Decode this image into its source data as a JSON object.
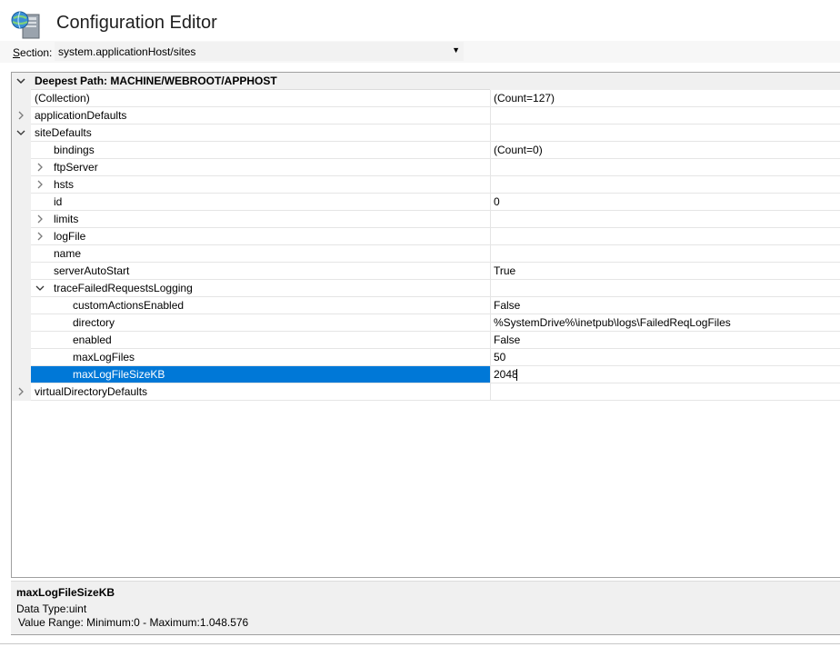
{
  "header": {
    "title": "Configuration Editor",
    "icon": "config-editor-icon"
  },
  "section": {
    "label_prefix": "S",
    "label_rest": "ection:",
    "value": "system.applicationHost/sites"
  },
  "grid": {
    "header_label": "Deepest Path: MACHINE/WEBROOT/APPHOST",
    "rows": [
      {
        "name": "(Collection)",
        "value": "(Count=127)"
      },
      {
        "name": "applicationDefaults",
        "value": ""
      },
      {
        "name": "siteDefaults",
        "value": ""
      },
      {
        "name": "bindings",
        "value": "(Count=0)"
      },
      {
        "name": "ftpServer",
        "value": ""
      },
      {
        "name": "hsts",
        "value": ""
      },
      {
        "name": "id",
        "value": "0"
      },
      {
        "name": "limits",
        "value": ""
      },
      {
        "name": "logFile",
        "value": ""
      },
      {
        "name": "name",
        "value": ""
      },
      {
        "name": "serverAutoStart",
        "value": "True"
      },
      {
        "name": "traceFailedRequestsLogging",
        "value": ""
      },
      {
        "name": "customActionsEnabled",
        "value": "False"
      },
      {
        "name": "directory",
        "value": "%SystemDrive%\\inetpub\\logs\\FailedReqLogFiles"
      },
      {
        "name": "enabled",
        "value": "False"
      },
      {
        "name": "maxLogFiles",
        "value": "50"
      },
      {
        "name": "maxLogFileSizeKB",
        "value": "2048"
      },
      {
        "name": "virtualDirectoryDefaults",
        "value": ""
      }
    ]
  },
  "info": {
    "name": "maxLogFileSizeKB",
    "data_type": "Data Type:uint",
    "value_range": "Value Range: Minimum:0 - Maximum:1.048.576"
  }
}
